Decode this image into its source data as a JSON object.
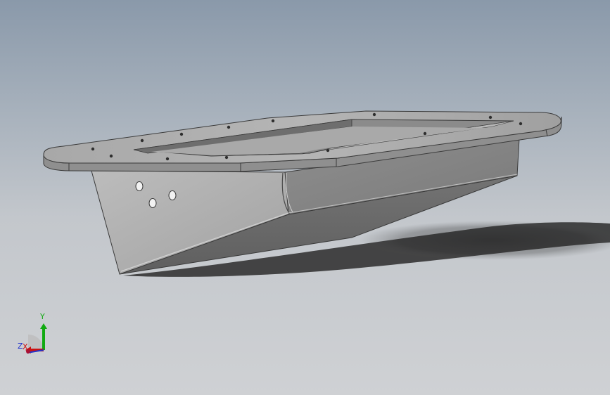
{
  "viewport": {
    "background_top": "#8a99aa",
    "background_bottom": "#cfd1d4"
  },
  "model": {
    "body_color": "#9a9a9a",
    "edge_color": "#3a3a3a"
  },
  "triad": {
    "x_label": "X",
    "y_label": "Y",
    "z_label": "Z",
    "x_color": "#cc1111",
    "y_color": "#11aa11",
    "z_color": "#2233cc"
  }
}
